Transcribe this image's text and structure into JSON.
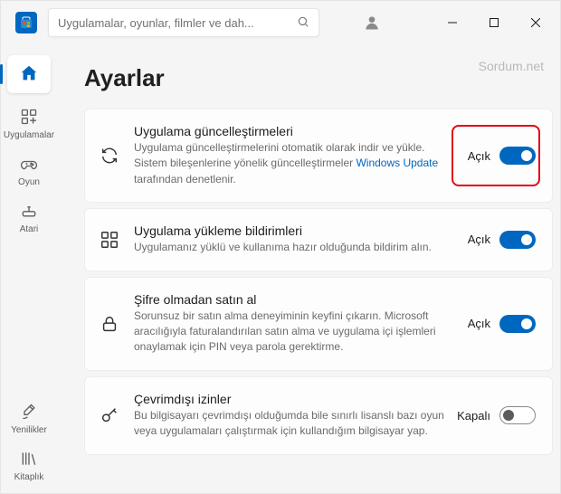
{
  "search": {
    "placeholder": "Uygulamalar, oyunlar, filmler ve dah..."
  },
  "watermark": "Sordum.net",
  "sidebar": {
    "home": "",
    "apps": "Uygulamalar",
    "game": "Oyun",
    "atari": "Atari",
    "news": "Yenilikler",
    "library": "Kitaplık"
  },
  "page": {
    "title": "Ayarlar"
  },
  "settings": [
    {
      "title": "Uygulama güncelleştirmeleri",
      "desc_pre": "Uygulama güncelleştirmelerini otomatik olarak indir ve yükle. Sistem bileşenlerine yönelik güncelleştirmeler ",
      "link": "Windows Update",
      "desc_post": " tarafından denetlenir.",
      "state": "Açık",
      "on": true
    },
    {
      "title": "Uygulama yükleme bildirimleri",
      "desc": "Uygulamanız yüklü ve kullanıma hazır olduğunda bildirim alın.",
      "state": "Açık",
      "on": true
    },
    {
      "title": "Şifre olmadan satın al",
      "desc": "Sorunsuz bir satın alma deneyiminin keyfini çıkarın. Microsoft aracılığıyla faturalandırılan satın alma ve uygulama içi işlemleri onaylamak için PIN veya parola gerektirme.",
      "state": "Açık",
      "on": true
    },
    {
      "title": "Çevrimdışı izinler",
      "desc": "Bu bilgisayarı çevrimdışı olduğumda bile sınırlı lisanslı bazı oyun veya uygulamaları çalıştırmak için kullandığım bilgisayar yap.",
      "state": "Kapalı",
      "on": false
    }
  ]
}
